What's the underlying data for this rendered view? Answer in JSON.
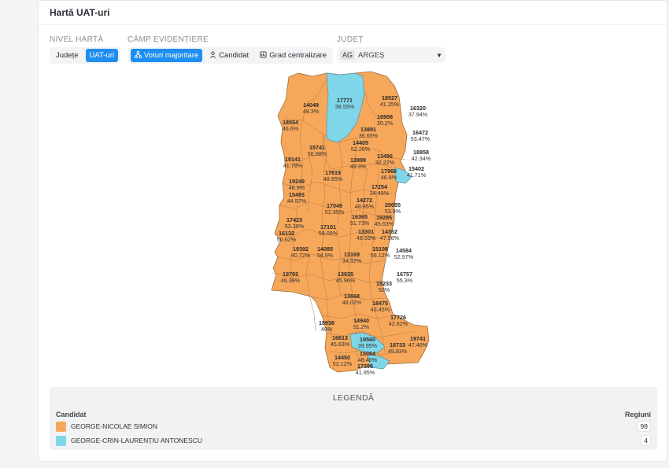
{
  "card": {
    "title": "Hartă UAT-uri"
  },
  "controls": {
    "level_label": "NIVEL HARTĂ",
    "level_options": [
      "Județe",
      "UAT-uri"
    ],
    "field_label": "CÂMP EVIDENȚIERE",
    "field_options": [
      "Voturi majoritare",
      "Candidat",
      "Grad centralizare"
    ],
    "county_label": "JUDEȚ",
    "county_code": "AG",
    "county_name": "ARGEȘ"
  },
  "colors": {
    "orange": "#f7a75a",
    "blue": "#7fd6e8",
    "accent": "#1f8ef1"
  },
  "map_labels": [
    {
      "v": "17771",
      "p": "38.55%"
    },
    {
      "v": "18527",
      "p": "41.25%"
    },
    {
      "v": "14049",
      "p": "48.3%"
    },
    {
      "v": "16320",
      "p": "37.94%"
    },
    {
      "v": "16908",
      "p": "30.2%"
    },
    {
      "v": "18554",
      "p": "46.6%"
    },
    {
      "v": "13891",
      "p": "36.65%"
    },
    {
      "v": "16472",
      "p": "53.47%"
    },
    {
      "v": "14405",
      "p": "52.26%"
    },
    {
      "v": "15741",
      "p": "56.98%"
    },
    {
      "v": "18858",
      "p": "42.34%"
    },
    {
      "v": "19141",
      "p": "41.78%"
    },
    {
      "v": "13999",
      "p": "49.3%"
    },
    {
      "v": "13496",
      "p": "32.22%"
    },
    {
      "v": "15402",
      "p": "41.71%"
    },
    {
      "v": "17619",
      "p": "48.65%"
    },
    {
      "v": "17968",
      "p": "46.8%"
    },
    {
      "v": "19249",
      "p": "48.9%"
    },
    {
      "v": "17254",
      "p": "34.49%"
    },
    {
      "v": "15493",
      "p": "44.57%"
    },
    {
      "v": "14272",
      "p": "48.85%"
    },
    {
      "v": "20055",
      "p": "53.9%"
    },
    {
      "v": "17049",
      "p": "51.35%"
    },
    {
      "v": "16365",
      "p": "51.73%"
    },
    {
      "v": "19285",
      "p": "45.63%"
    },
    {
      "v": "17423",
      "p": "53.38%"
    },
    {
      "v": "17101",
      "p": "58.05%"
    },
    {
      "v": "13301",
      "p": "48.59%"
    },
    {
      "v": "14352",
      "p": "47.98%"
    },
    {
      "v": "16132",
      "p": "50.62%"
    },
    {
      "v": "19392",
      "p": "40.72%"
    },
    {
      "v": "14085",
      "p": "54.9%"
    },
    {
      "v": "15108",
      "p": "56.12%"
    },
    {
      "v": "14584",
      "p": "52.97%"
    },
    {
      "v": "13169",
      "p": "34.92%"
    },
    {
      "v": "19793",
      "p": "46.38%"
    },
    {
      "v": "13935",
      "p": "45.96%"
    },
    {
      "v": "16757",
      "p": "55.3%"
    },
    {
      "v": "15233",
      "p": "50%"
    },
    {
      "v": "13668",
      "p": "48.02%"
    },
    {
      "v": "18475",
      "p": "43.45%"
    },
    {
      "v": "17726",
      "p": "42.62%"
    },
    {
      "v": "18938",
      "p": "49%"
    },
    {
      "v": "14940",
      "p": "51.2%"
    },
    {
      "v": "16613",
      "p": "45.63%"
    },
    {
      "v": "19560",
      "p": "39.95%"
    },
    {
      "v": "18733",
      "p": "49.93%"
    },
    {
      "v": "19741",
      "p": "47.46%"
    },
    {
      "v": "15064",
      "p": "48.46%"
    },
    {
      "v": "14450",
      "p": "52.12%"
    },
    {
      "v": "17398",
      "p": "41.95%"
    }
  ],
  "legend": {
    "title": "LEGENDĂ",
    "candidate_header": "Candidat",
    "regions_header": "Regiuni",
    "rows": [
      {
        "name": "GEORGE-NICOLAE SIMION",
        "color": "#f7a75a",
        "count": "98"
      },
      {
        "name": "GEORGE-CRIN-LAURENȚIU ANTONESCU",
        "color": "#7fd6e8",
        "count": "4"
      }
    ]
  }
}
